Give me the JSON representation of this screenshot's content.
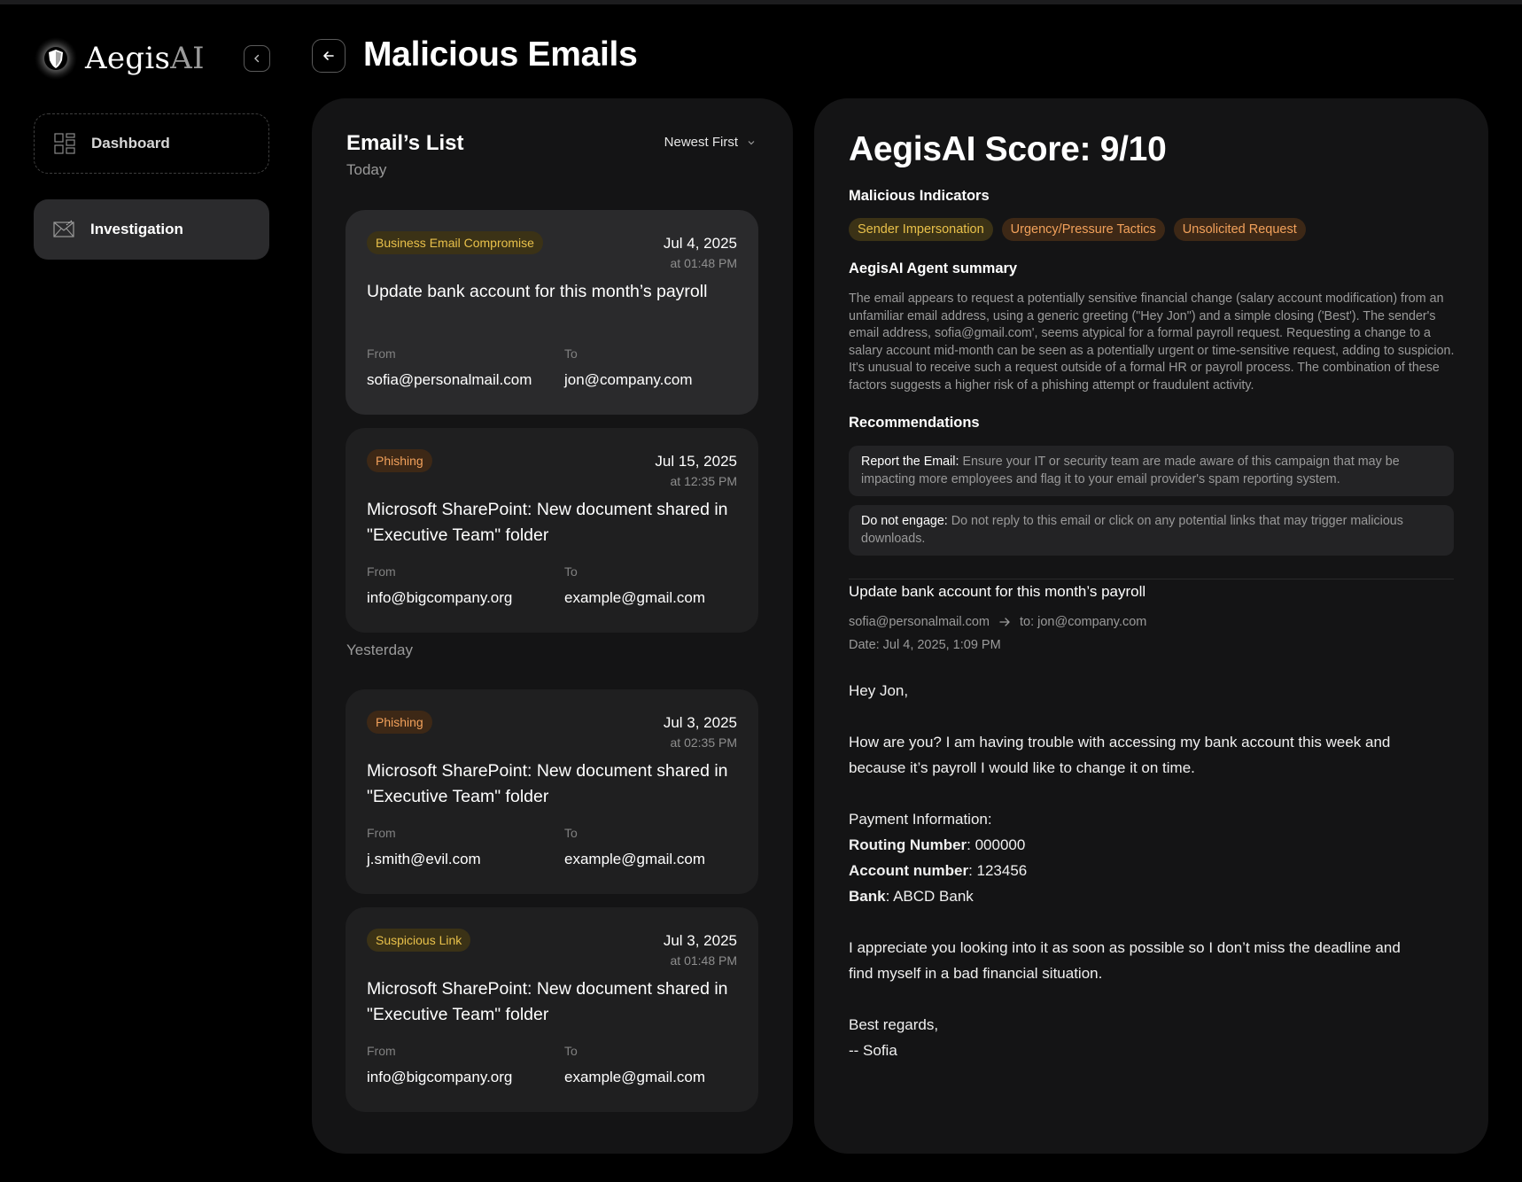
{
  "app": {
    "logo_main": "Aegis",
    "logo_ai": "AI"
  },
  "sidebar": {
    "items": [
      {
        "label": "Dashboard",
        "icon": "grid-icon"
      },
      {
        "label": "Investigation",
        "icon": "mail-scan-icon",
        "active": true
      }
    ]
  },
  "header": {
    "title": "Malicious Emails"
  },
  "email_list": {
    "title": "Email’s List",
    "sort_label": "Newest First",
    "sections": [
      "Today",
      "Yesterday"
    ],
    "from_label": "From",
    "to_label": "To",
    "cards": [
      {
        "tag": "Business Email Compromise",
        "date": "Jul 4, 2025",
        "time": "at 01:48 PM",
        "subject": "Update bank account for this month’s payroll",
        "from": "sofia@personalmail.com",
        "to": "jon@company.com"
      },
      {
        "tag": "Phishing",
        "date": "Jul 15, 2025",
        "time": "at 12:35 PM",
        "subject": "Microsoft SharePoint: New document shared in \"Executive Team\" folder",
        "from": "info@bigcompany.org",
        "to": "example@gmail.com"
      },
      {
        "tag": "Phishing",
        "date": "Jul 3, 2025",
        "time": "at 02:35 PM",
        "subject": "Microsoft SharePoint: New document shared in \"Executive Team\" folder",
        "from": "j.smith@evil.com",
        "to": "example@gmail.com"
      },
      {
        "tag": "Suspicious Link",
        "date": "Jul 3, 2025",
        "time": "at 01:48 PM",
        "subject": "Microsoft SharePoint: New document shared in \"Executive Team\" folder",
        "from": "info@bigcompany.org",
        "to": "example@gmail.com"
      }
    ]
  },
  "detail": {
    "score": "AegisAI Score: 9/10",
    "indicators_title": "Malicious Indicators",
    "indicators": [
      "Sender Impersonation",
      "Urgency/Pressure Tactics",
      "Unsolicited Request"
    ],
    "summary_title": "AegisAI Agent summary",
    "summary": "The email appears to request a potentially sensitive financial change (salary account modification) from an unfamiliar email address, using a generic greeting (\"Hey Jon\") and a simple closing ('Best'). The sender's email address, sofia@gmail.com', seems atypical for a formal payroll request. Requesting a change to a salary account mid-month can be seen as a potentially urgent or time-sensitive request, adding to suspicion. It's unusual to receive such a request outside of a formal HR or payroll process. The combination of these factors suggests a higher risk of a phishing attempt or fraudulent activity.",
    "recommendations_title": "Recommendations",
    "recommendations": [
      {
        "title": "Report the Email:",
        "text": "Ensure your IT or security team are made aware of this campaign that may be impacting more employees and flag it to your email provider's spam reporting system."
      },
      {
        "title": "Do not engage:",
        "text": "Do not reply to this email or click on any potential links that may trigger malicious downloads."
      }
    ],
    "email": {
      "subject": "Update bank account for this month’s payroll",
      "from": "sofia@personalmail.com",
      "to": "to: jon@company.com",
      "date": "Date: Jul 4, 2025, 1:09 PM",
      "greeting": "Hey Jon,",
      "para1": "How are you? I am having trouble with accessing my bank account this week and because it’s payroll I would like to change it on time.",
      "payment_heading": "Payment Information:",
      "routing_label": "Routing Number",
      "routing_value": ": 000000",
      "account_label": "Account number",
      "account_value": ": 123456",
      "bank_label": "Bank",
      "bank_value": ": ABCD Bank",
      "para2": "I appreciate you looking into it as soon as possible so I don’t miss the deadline and find myself in a bad financial situation.",
      "closing": "Best regards,",
      "signature": "-- Sofia"
    }
  },
  "colors": {
    "tag_yellow_bg": "#3b3216",
    "tag_yellow_fg": "#e8c04a",
    "tag_orange_bg": "#3d2816",
    "tag_orange_fg": "#f2a15b"
  }
}
